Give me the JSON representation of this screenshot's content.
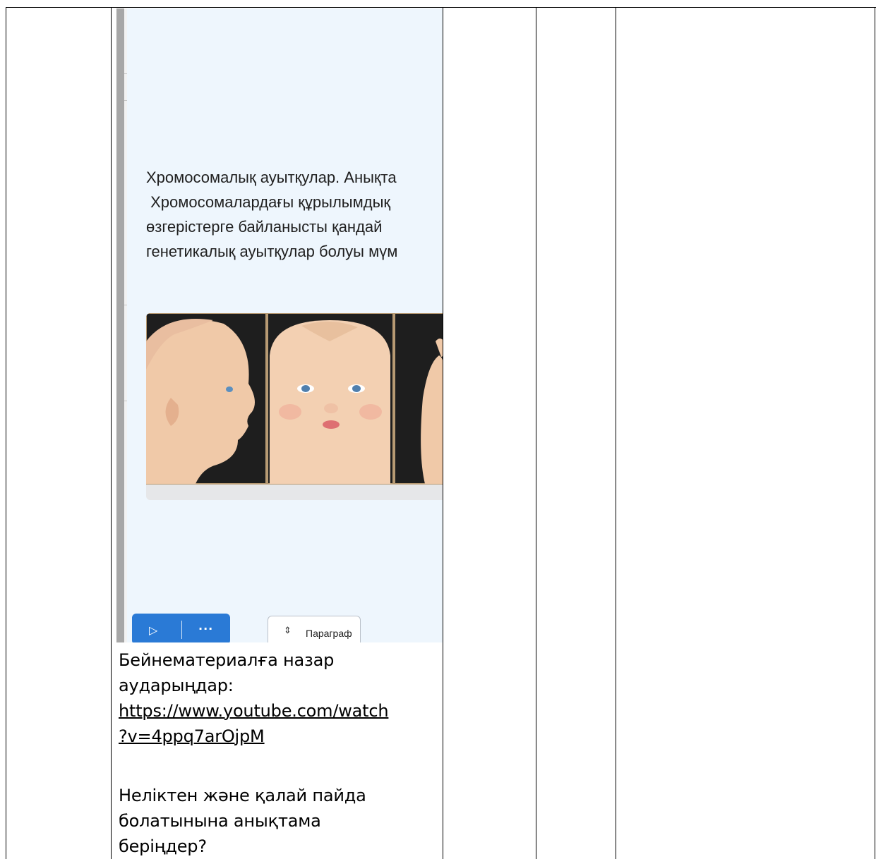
{
  "screenshot": {
    "heading_lines": [
      "Хромосомалық ауытқулар. Анықта",
      " Хромосомалардағы құрылымдық",
      "өзгерістерге байланысты қандай",
      "генетикалық ауытқулар болуы мүм"
    ],
    "play_icon": "play-icon",
    "more_icon": "more-icon",
    "paragraph_button_label": "Параграф",
    "paragraph_icon": "chevron-updown-icon"
  },
  "cell": {
    "intro_line1": "Бейнематериалға назар",
    "intro_line2": "аударыңдар:",
    "link_line1": "https://www.youtube.com/watch",
    "link_line2": "?v=4ppq7arOjpM",
    "question_line1": "Неліктен және қалай пайда",
    "question_line2": "болатынына анықтама",
    "question_line3": "беріңдер?"
  }
}
